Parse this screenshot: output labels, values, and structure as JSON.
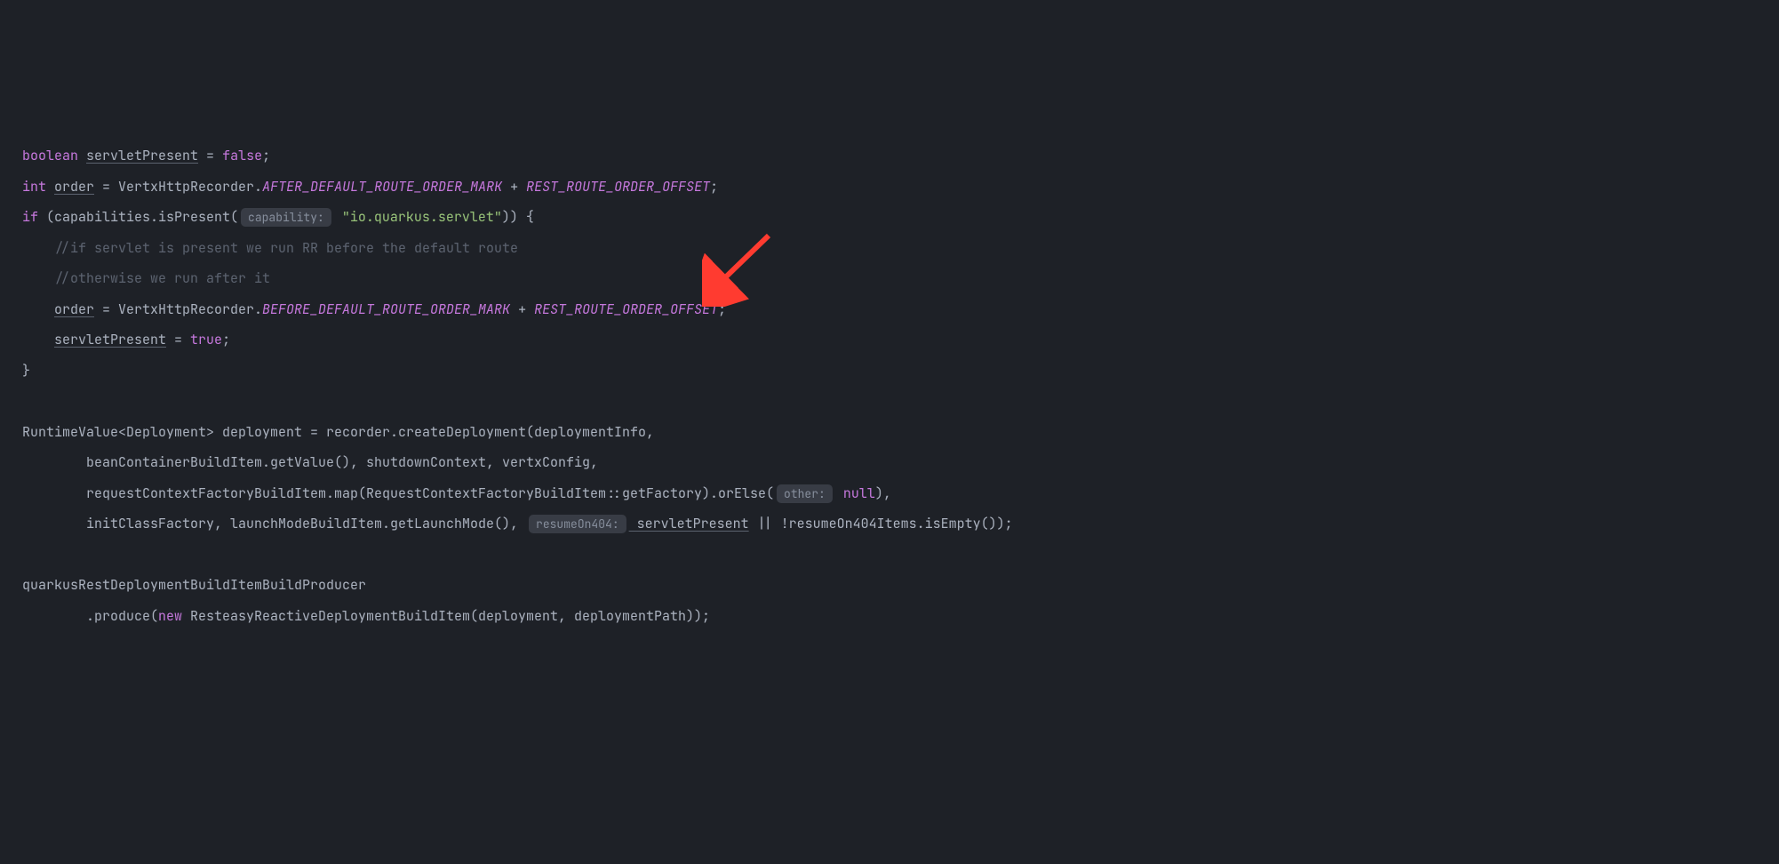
{
  "line1": {
    "kw_boolean": "boolean",
    "var": "servletPresent",
    "op": " = ",
    "val": "false",
    "semi": ";"
  },
  "line2": {
    "kw_int": "int",
    "var": "order",
    "op": " = VertxHttpRecorder.",
    "const1": "AFTER_DEFAULT_ROUTE_ORDER_MARK",
    "plus": " + ",
    "const2": "REST_ROUTE_ORDER_OFFSET",
    "semi": ";"
  },
  "line3": {
    "kw_if": "if",
    "open": " (capabilities.isPresent(",
    "hint": "capability:",
    "str": " \"io.quarkus.servlet\"",
    "close": ")) {"
  },
  "line4": {
    "comment": "    //if servlet is present we run RR before the default route"
  },
  "line5": {
    "comment": "    //otherwise we run after it"
  },
  "line6": {
    "indent": "    ",
    "var": "order",
    "op": " = VertxHttpRecorder.",
    "const1": "BEFORE_DEFAULT_ROUTE_ORDER_MARK",
    "plus": " + ",
    "const2": "REST_ROUTE_ORDER_OFFSET",
    "semi": ";"
  },
  "line7": {
    "indent": "    ",
    "var": "servletPresent",
    "op": " = ",
    "val": "true",
    "semi": ";"
  },
  "line8": {
    "text": "}"
  },
  "line10": {
    "text1": "RuntimeValue<Deployment> deployment = recorder.createDeployment(deploymentInfo,"
  },
  "line11": {
    "text": "        beanContainerBuildItem.getValue(), shutdownContext, vertxConfig,"
  },
  "line12": {
    "text1": "        requestContextFactoryBuildItem.map(RequestContextFactoryBuildItem::getFactory).orElse(",
    "hint": "other:",
    "null_kw": " null",
    "text2": "),"
  },
  "line13": {
    "text1": "        initClassFactory, launchModeBuildItem.getLaunchMode(), ",
    "hint": "resumeOn404:",
    "var": " servletPresent",
    "text2": " || !resumeOn404Items.isEmpty());"
  },
  "line15": {
    "text": "quarkusRestDeploymentBuildItemBuildProducer"
  },
  "line16": {
    "text1": "        .produce(",
    "kw_new": "new",
    "text2": " ResteasyReactiveDeploymentBuildItem(deployment, deploymentPath));"
  }
}
